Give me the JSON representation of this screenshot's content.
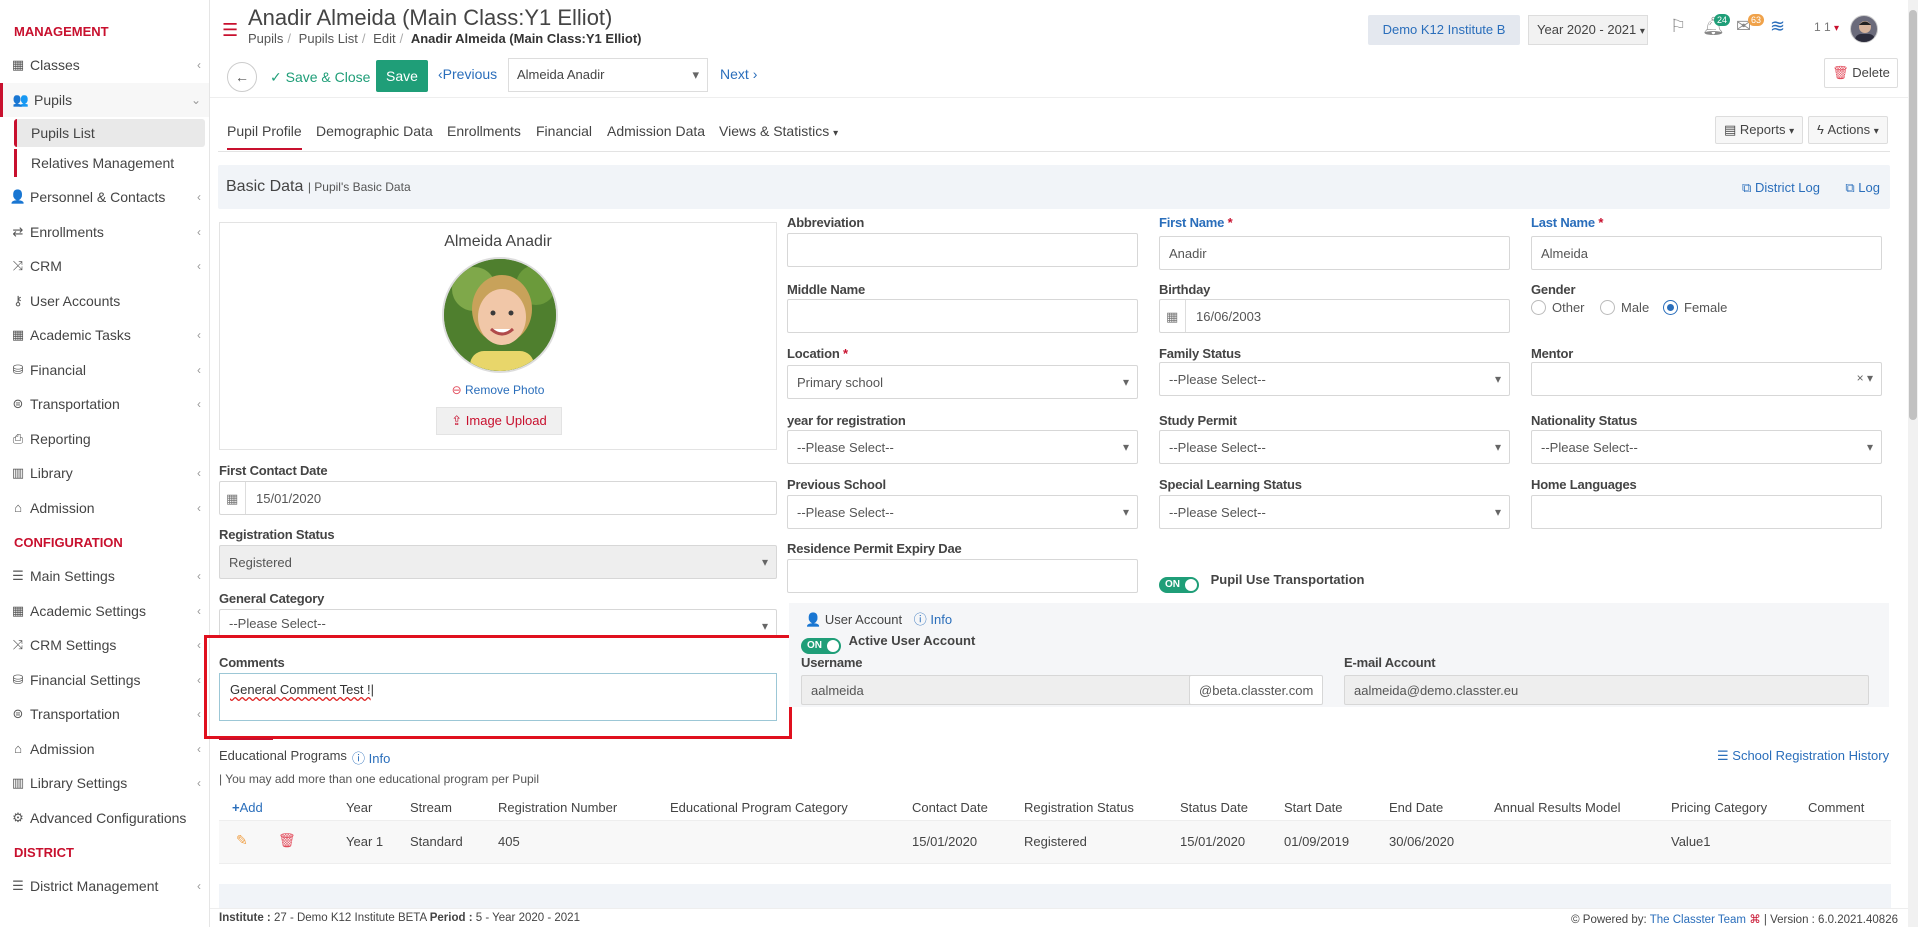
{
  "sidebar": {
    "management_title": "MANAGEMENT",
    "management": [
      {
        "label": "Classes",
        "icon": "grid-icon"
      },
      {
        "label": "Pupils",
        "icon": "users-icon",
        "open": true
      },
      {
        "label": "Personnel & Contacts",
        "icon": "user-icon"
      },
      {
        "label": "Enrollments",
        "icon": "exchange-icon"
      },
      {
        "label": "CRM",
        "icon": "shuffle-icon"
      },
      {
        "label": "User Accounts",
        "icon": "key-icon"
      },
      {
        "label": "Academic Tasks",
        "icon": "table-icon"
      },
      {
        "label": "Financial",
        "icon": "coins-icon"
      },
      {
        "label": "Transportation",
        "icon": "bus-icon"
      },
      {
        "label": "Reporting",
        "icon": "print-icon"
      },
      {
        "label": "Library",
        "icon": "books-icon"
      },
      {
        "label": "Admission",
        "icon": "building-icon"
      }
    ],
    "pupils_sub": [
      "Pupils List",
      "Relatives Management"
    ],
    "configuration_title": "CONFIGURATION",
    "configuration": [
      {
        "label": "Main Settings",
        "icon": "sliders-icon"
      },
      {
        "label": "Academic Settings",
        "icon": "grid-icon"
      },
      {
        "label": "CRM Settings",
        "icon": "shuffle-icon"
      },
      {
        "label": "Financial Settings",
        "icon": "coins-icon"
      },
      {
        "label": "Transportation",
        "icon": "bus-icon"
      },
      {
        "label": "Admission",
        "icon": "building-icon"
      },
      {
        "label": "Library Settings",
        "icon": "books-icon"
      },
      {
        "label": "Advanced Configurations",
        "icon": "cogs-icon"
      }
    ],
    "district_title": "DISTRICT",
    "district": [
      {
        "label": "District Management",
        "icon": "list-icon"
      }
    ]
  },
  "header": {
    "title": "Anadir Almeida (Main Class:Y1 Elliot)",
    "breadcrumbs": [
      "Pupils",
      "Pupils List",
      "Edit"
    ],
    "breadcrumb_current": "Anadir Almeida (Main Class:Y1 Elliot)",
    "institute": "Demo K12 Institute B",
    "year": "Year 2020 - 2021",
    "notif_count": "24",
    "mail_count": "63",
    "user_short": "1 1"
  },
  "actionbar": {
    "save_close": "Save & Close",
    "save": "Save",
    "previous": "Previous",
    "pupil_select": "Almeida Anadir",
    "next": "Next",
    "delete": "Delete"
  },
  "tabs": [
    "Pupil Profile",
    "Demographic Data",
    "Enrollments",
    "Financial",
    "Admission Data",
    "Views & Statistics"
  ],
  "tab_buttons": {
    "reports": "Reports",
    "actions": "Actions"
  },
  "basic": {
    "title": "Basic Data",
    "subtitle": "Pupil's Basic Data",
    "district_log": "District Log",
    "log": "Log"
  },
  "photo": {
    "name": "Almeida Anadir",
    "remove": "Remove Photo",
    "upload": "Image Upload"
  },
  "form": {
    "abbreviation": {
      "label": "Abbreviation",
      "value": ""
    },
    "first_name": {
      "label": "First Name",
      "value": "Anadir"
    },
    "last_name": {
      "label": "Last Name",
      "value": "Almeida"
    },
    "middle_name": {
      "label": "Middle Name",
      "value": ""
    },
    "birthday": {
      "label": "Birthday",
      "value": "16/06/2003"
    },
    "gender": {
      "label": "Gender",
      "options": [
        "Other",
        "Male",
        "Female"
      ],
      "selected": "Female"
    },
    "location": {
      "label": "Location",
      "value": "Primary school"
    },
    "family_status": {
      "label": "Family Status",
      "value": "--Please Select--"
    },
    "mentor": {
      "label": "Mentor",
      "value": ""
    },
    "year_registration": {
      "label": "year for registration",
      "value": "--Please Select--"
    },
    "study_permit": {
      "label": "Study Permit",
      "value": "--Please Select--"
    },
    "nationality_status": {
      "label": "Nationality Status",
      "value": "--Please Select--"
    },
    "previous_school": {
      "label": "Previous School",
      "value": "--Please Select--"
    },
    "special_learning": {
      "label": "Special Learning Status",
      "value": "--Please Select--"
    },
    "home_languages": {
      "label": "Home Languages",
      "value": ""
    },
    "residence_permit": {
      "label": "Residence Permit Expiry Dae",
      "value": ""
    },
    "transport": {
      "label": "Pupil Use Transportation",
      "toggle": "ON"
    },
    "first_contact": {
      "label": "First Contact Date",
      "value": "15/01/2020"
    },
    "reg_status": {
      "label": "Registration Status",
      "value": "Registered"
    },
    "general_category": {
      "label": "General Category",
      "value": "--Please Select--"
    },
    "comments": {
      "label": "Comments",
      "value": "General Comment Test !"
    }
  },
  "user_account": {
    "title": "User Account",
    "info": "Info",
    "active_label": "Active User Account",
    "toggle": "ON",
    "username_label": "Username",
    "username": "aalmeida",
    "domain": "@beta.classter.com",
    "email_label": "E-mail Account",
    "email": "aalmeida@demo.classter.eu"
  },
  "edu": {
    "title": "Educational Programs",
    "info": "Info",
    "note": "| You may add more than one educational program per Pupil",
    "history": "School Registration History",
    "add": "Add",
    "columns": [
      "Year",
      "Stream",
      "Registration Number",
      "Educational Program Category",
      "Contact Date",
      "Registration Status",
      "Status Date",
      "Start Date",
      "End Date",
      "Annual Results Model",
      "Pricing Category",
      "Comment"
    ],
    "row": [
      "Year 1",
      "Standard",
      "405",
      "",
      "15/01/2020",
      "Registered",
      "15/01/2020",
      "01/09/2019",
      "30/06/2020",
      "",
      "Value1",
      ""
    ]
  },
  "footer": {
    "institute_label": "Institute :",
    "institute": "27 - Demo K12 Institute BETA",
    "period_label": "Period :",
    "period": "5 - Year 2020 - 2021",
    "powered": "Powered by:",
    "team": "The Classter Team",
    "version": "| Version : 6.0.2021.40826"
  }
}
